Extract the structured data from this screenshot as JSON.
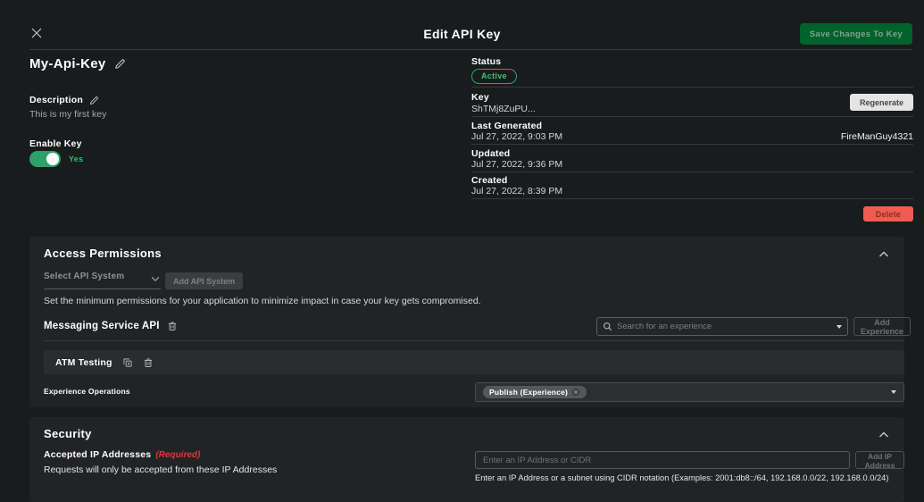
{
  "header": {
    "title": "Edit API Key",
    "save_button": "Save Changes To Key"
  },
  "key_info": {
    "name": "My-Api-Key",
    "description_label": "Description",
    "description": "This is my first key",
    "enable_label": "Enable Key",
    "enable_value": "Yes",
    "status_label": "Status",
    "status_value": "Active",
    "key_label": "Key",
    "key_value": "ShTMj8ZuPU...",
    "regenerate_button": "Regenerate",
    "last_generated_label": "Last Generated",
    "last_generated_value": "Jul 27, 2022, 9:03 PM",
    "generated_by": "FireManGuy4321",
    "updated_label": "Updated",
    "updated_value": "Jul 27, 2022, 9:36 PM",
    "created_label": "Created",
    "created_value": "Jul 27, 2022, 8:39 PM",
    "delete_button": "Delete"
  },
  "access_permissions": {
    "title": "Access Permissions",
    "select_api_system": "Select API System",
    "add_api_system_button": "Add API System",
    "hint": "Set the minimum permissions for your application to minimize impact in case your key gets compromised.",
    "api_name": "Messaging Service API",
    "search_placeholder": "Search for an experience",
    "add_experience_button": "Add Experience",
    "experience_name": "ATM Testing",
    "operations_label": "Experience Operations",
    "selected_operation": "Publish (Experience)"
  },
  "security": {
    "title": "Security",
    "ip_label": "Accepted IP Addresses",
    "required_note": "(Required)",
    "ip_description": "Requests will only be accepted from these IP Addresses",
    "ip_placeholder": "Enter an IP Address or CIDR",
    "add_ip_button": "Add IP Address",
    "ip_hint": "Enter an IP Address or a subnet using CIDR notation (Examples: 2001:db8::/64, 192.168.0.0/22, 192.168.0.0/24)"
  },
  "colors": {
    "accent_green": "#2DA169",
    "badge_green": "#3FC379",
    "save_button_bg": "#00622C",
    "delete_bg": "#F15B50",
    "required_red": "#DC3B33",
    "page_bg": "#191B1C",
    "card_bg": "#212325"
  }
}
